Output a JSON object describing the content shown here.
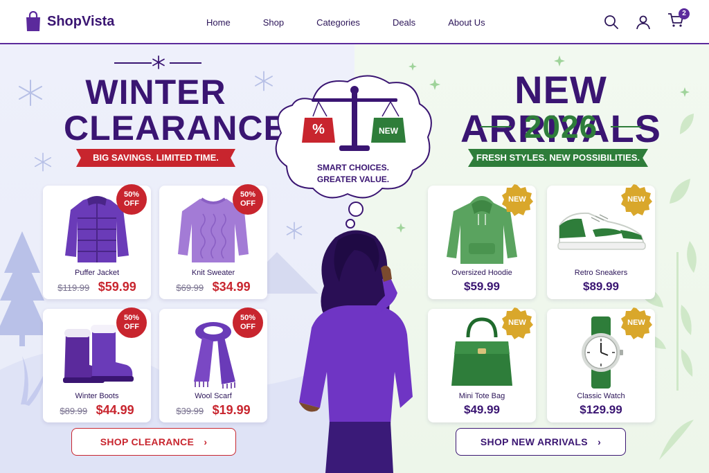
{
  "brand": {
    "name": "ShopVista",
    "accent": "#3a1572",
    "sale_red": "#c8252e",
    "new_green": "#2e7d3a",
    "new_gold": "#d9a72b"
  },
  "nav": {
    "links": [
      "Home",
      "Shop",
      "Categories",
      "Deals",
      "About Us"
    ],
    "icons": [
      "search-icon",
      "user-icon",
      "cart-icon"
    ],
    "cart_count": "2"
  },
  "clearance": {
    "title_line1": "WINTER",
    "title_line2": "CLEARANCE",
    "ribbon": "BIG SAVINGS. LIMITED TIME.",
    "badge_line1": "50%",
    "badge_line2": "OFF",
    "products": [
      {
        "name": "Puffer Jacket",
        "old_price": "$119.99",
        "price": "$59.99",
        "icon": "puffer-jacket-icon"
      },
      {
        "name": "Knit Sweater",
        "old_price": "$69.99",
        "price": "$34.99",
        "icon": "sweater-icon"
      },
      {
        "name": "Winter Boots",
        "old_price": "$89.99",
        "price": "$44.99",
        "icon": "boots-icon"
      },
      {
        "name": "Wool Scarf",
        "old_price": "$39.99",
        "price": "$19.99",
        "icon": "scarf-icon"
      }
    ],
    "cta": "SHOP CLEARANCE"
  },
  "arrivals": {
    "title_line1": "NEW ARRIVALS",
    "title_line2": "2026",
    "ribbon": "FRESH STYLES. NEW POSSIBILITIES.",
    "badge": "NEW",
    "products": [
      {
        "name": "Oversized Hoodie",
        "price": "$59.99",
        "icon": "hoodie-icon"
      },
      {
        "name": "Retro Sneakers",
        "price": "$89.99",
        "icon": "sneakers-icon"
      },
      {
        "name": "Mini Tote Bag",
        "price": "$49.99",
        "icon": "tote-bag-icon"
      },
      {
        "name": "Classic Watch",
        "price": "$129.99",
        "icon": "watch-icon"
      }
    ],
    "cta": "SHOP NEW ARRIVALS"
  },
  "thought": {
    "line1": "SMART CHOICES.",
    "line2": "GREATER VALUE.",
    "scale_left_tag": "%",
    "scale_right_tag": "NEW"
  }
}
